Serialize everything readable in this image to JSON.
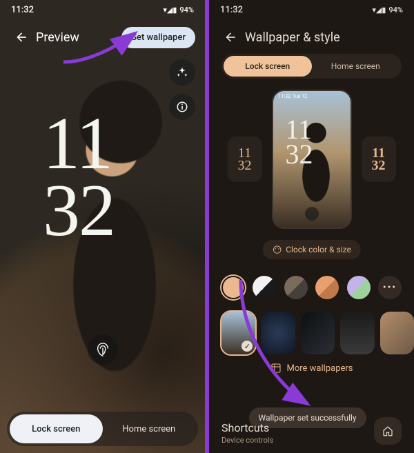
{
  "left": {
    "status": {
      "time": "11:32",
      "battery": "94%",
      "icons": "▾◢▮"
    },
    "topbar": {
      "title": "Preview",
      "set_wallpaper": "Set wallpaper"
    },
    "clock": {
      "line1": "11",
      "line2": "32"
    },
    "tabs": {
      "lock": "Lock screen",
      "home": "Home screen"
    }
  },
  "right": {
    "status": {
      "time": "11:32",
      "battery": "94%",
      "icons": "▾◢▮"
    },
    "title": "Wallpaper & style",
    "tabs": {
      "lock": "Lock screen",
      "home": "Home screen"
    },
    "clock_styles": {
      "left": {
        "l1": "11",
        "l2": "32"
      },
      "right": {
        "l1": "11",
        "l2": "32"
      }
    },
    "preview": {
      "mini_status": "11:32, Tue 12",
      "l1": "11",
      "l2": "32"
    },
    "clock_color_chip": "Clock color & size",
    "swatches": [
      "#e9b98f",
      "#f2f2f2",
      "#7a6b5c",
      "#e8a06e",
      "#c3b4e8"
    ],
    "swatch_inner": [
      "",
      "#1a1a1a",
      "#47403a",
      "#c07a47",
      "#9dd29d"
    ],
    "thumbs_bg": [
      "linear-gradient(#a8c1d7,#3a2f24)",
      "radial-gradient(circle,#2b3a55,#0e1726)",
      "linear-gradient(135deg,#0d0f12,#2a2e33)",
      "linear-gradient(#1a1a1a,#3a3a3a)",
      "linear-gradient(135deg,#b38d6a,#6e5a46)"
    ],
    "more_wallpapers": "More wallpapers",
    "toast": "Wallpaper set successfully",
    "shortcuts": {
      "title": "Shortcuts",
      "sub": "Device controls"
    }
  }
}
